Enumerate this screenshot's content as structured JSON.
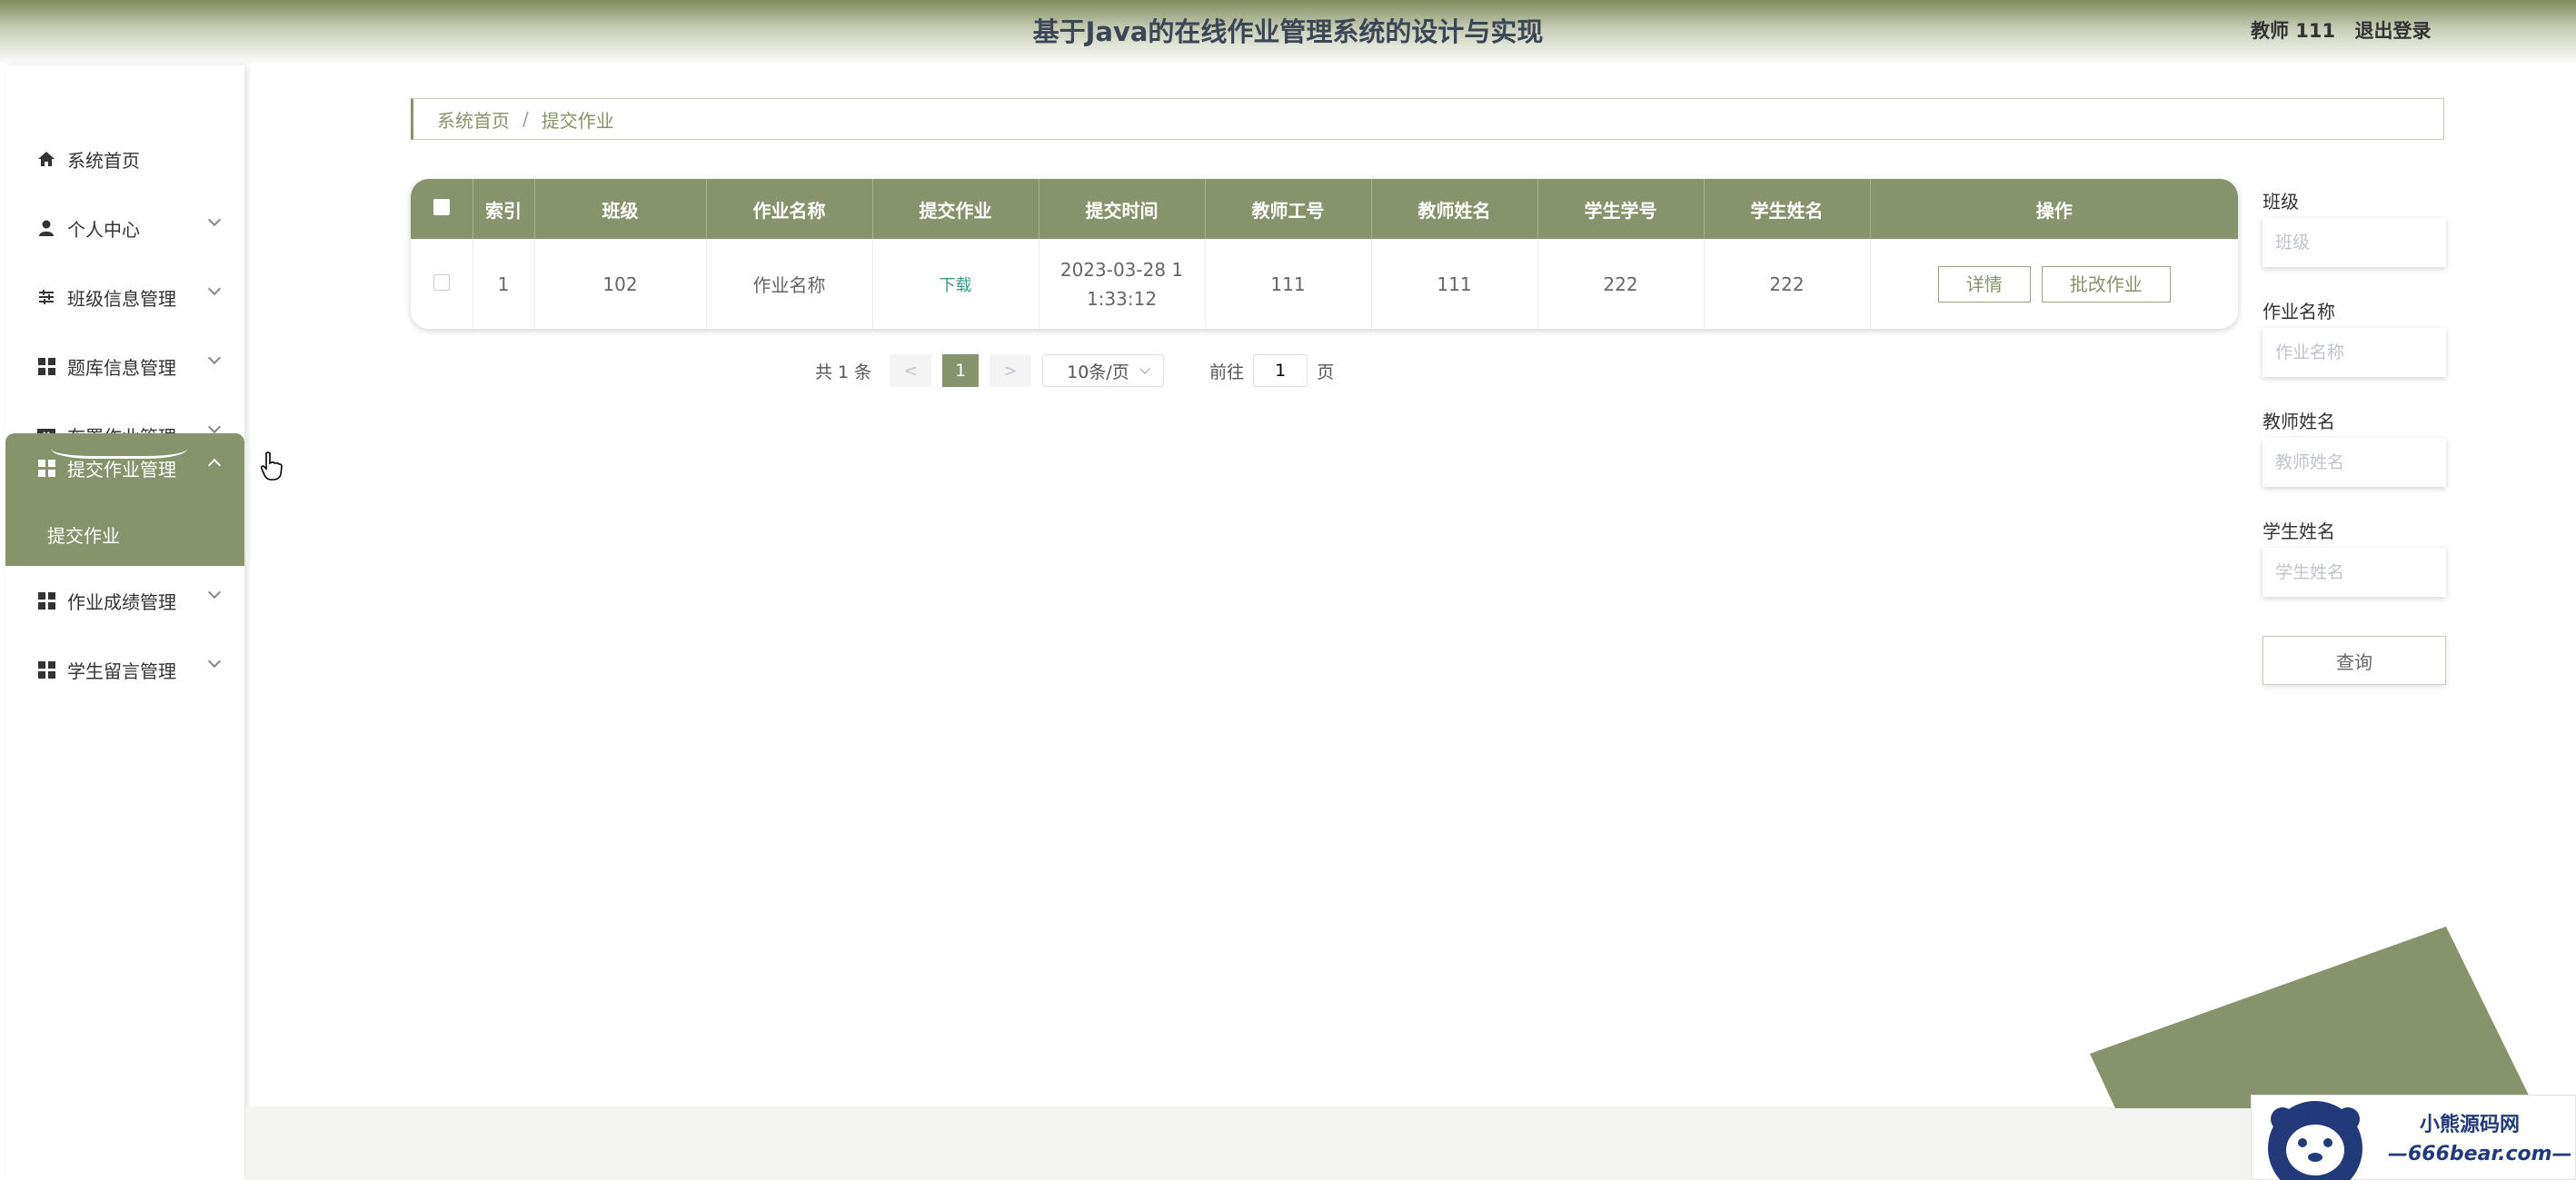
{
  "header": {
    "title": "基于Java的在线作业管理系统的设计与实现",
    "user": "教师 111",
    "logout": "退出登录"
  },
  "sidebar": {
    "items": [
      {
        "label": "系统首页",
        "icon": "home-icon"
      },
      {
        "label": "个人中心",
        "icon": "user-icon"
      },
      {
        "label": "班级信息管理",
        "icon": "sliders-icon"
      },
      {
        "label": "题库信息管理",
        "icon": "grid-icon"
      },
      {
        "label": "布置作业管理",
        "icon": "ticket-icon"
      },
      {
        "label": "提交作业管理",
        "icon": "grid-icon"
      },
      {
        "label": "作业成绩管理",
        "icon": "grid-icon"
      },
      {
        "label": "学生留言管理",
        "icon": "grid-icon"
      }
    ],
    "submenu": "提交作业"
  },
  "breadcrumb": {
    "home": "系统首页",
    "sep": "/",
    "current": "提交作业"
  },
  "table": {
    "headers": [
      "索引",
      "班级",
      "作业名称",
      "提交作业",
      "提交时间",
      "教师工号",
      "教师姓名",
      "学生学号",
      "学生姓名",
      "操作"
    ],
    "rows": [
      {
        "index": "1",
        "class": "102",
        "name": "作业名称",
        "file": "下载",
        "time": "2023-03-28 11:33:12",
        "teacher_id": "111",
        "teacher_name": "111",
        "student_id": "222",
        "student_name": "222",
        "detail": "详情",
        "grade": "批改作业"
      }
    ]
  },
  "pager": {
    "total": "共 1 条",
    "prev": "<",
    "current": "1",
    "next": ">",
    "size": "10条/页",
    "goto": "前往",
    "page_value": "1",
    "page_unit": "页"
  },
  "search": {
    "class_label": "班级",
    "class_placeholder": "班级",
    "name_label": "作业名称",
    "name_placeholder": "作业名称",
    "teacher_label": "教师姓名",
    "teacher_placeholder": "教师姓名",
    "student_label": "学生姓名",
    "student_placeholder": "学生姓名",
    "button": "查询"
  },
  "watermark": {
    "line1": "小熊源码网",
    "line2": "—666bear.com—"
  },
  "colors": {
    "accent": "#87936a",
    "title": "#3d4656",
    "link": "#3a9a88"
  }
}
